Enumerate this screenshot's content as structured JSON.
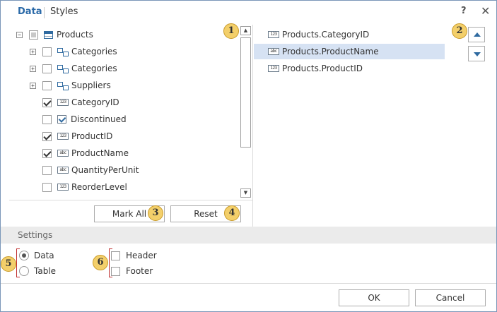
{
  "tabs": [
    {
      "label": "Data",
      "active": true
    },
    {
      "label": "Styles",
      "active": false
    }
  ],
  "window": {
    "help_label": "?",
    "close_label": "✕"
  },
  "tree": {
    "root": {
      "label": "Products",
      "expander": "−"
    },
    "items": [
      {
        "label": "Categories",
        "expander": "+",
        "checked": false,
        "icon": "relation-icon"
      },
      {
        "label": "Categories",
        "expander": "+",
        "checked": false,
        "icon": "relation-icon"
      },
      {
        "label": "Suppliers",
        "expander": "+",
        "checked": false,
        "icon": "relation-icon"
      },
      {
        "label": "CategoryID",
        "checked": true,
        "icon": "number-field-icon",
        "icon_text": "123"
      },
      {
        "label": "Discontinued",
        "checked": false,
        "icon": "boolean-field-icon"
      },
      {
        "label": "ProductID",
        "checked": true,
        "icon": "number-field-icon",
        "icon_text": "123"
      },
      {
        "label": "ProductName",
        "checked": true,
        "icon": "text-field-icon",
        "icon_text": "abc"
      },
      {
        "label": "QuantityPerUnit",
        "checked": false,
        "icon": "text-field-icon",
        "icon_text": "abc"
      },
      {
        "label": "ReorderLevel",
        "checked": false,
        "icon": "number-field-icon",
        "icon_text": "123"
      }
    ]
  },
  "buttons": {
    "mark_all": "Mark All",
    "reset": "Reset",
    "ok": "OK",
    "cancel": "Cancel"
  },
  "selected_fields": [
    {
      "label": "Products.CategoryID",
      "icon_text": "123",
      "selected": false
    },
    {
      "label": "Products.ProductName",
      "icon_text": "abc",
      "selected": true
    },
    {
      "label": "Products.ProductID",
      "icon_text": "123",
      "selected": false
    }
  ],
  "settings": {
    "title": "Settings",
    "layout_options": [
      {
        "label": "Data",
        "selected": true
      },
      {
        "label": "Table",
        "selected": false
      }
    ],
    "options": [
      {
        "label": "Header",
        "checked": false
      },
      {
        "label": "Footer",
        "checked": false
      }
    ]
  },
  "callouts": [
    "1",
    "2",
    "3",
    "4",
    "5",
    "6"
  ],
  "colors": {
    "accent": "#2b6aa8",
    "selection": "#d6e2f3",
    "callout": "#f3cf6a",
    "bracket": "#c03030"
  }
}
